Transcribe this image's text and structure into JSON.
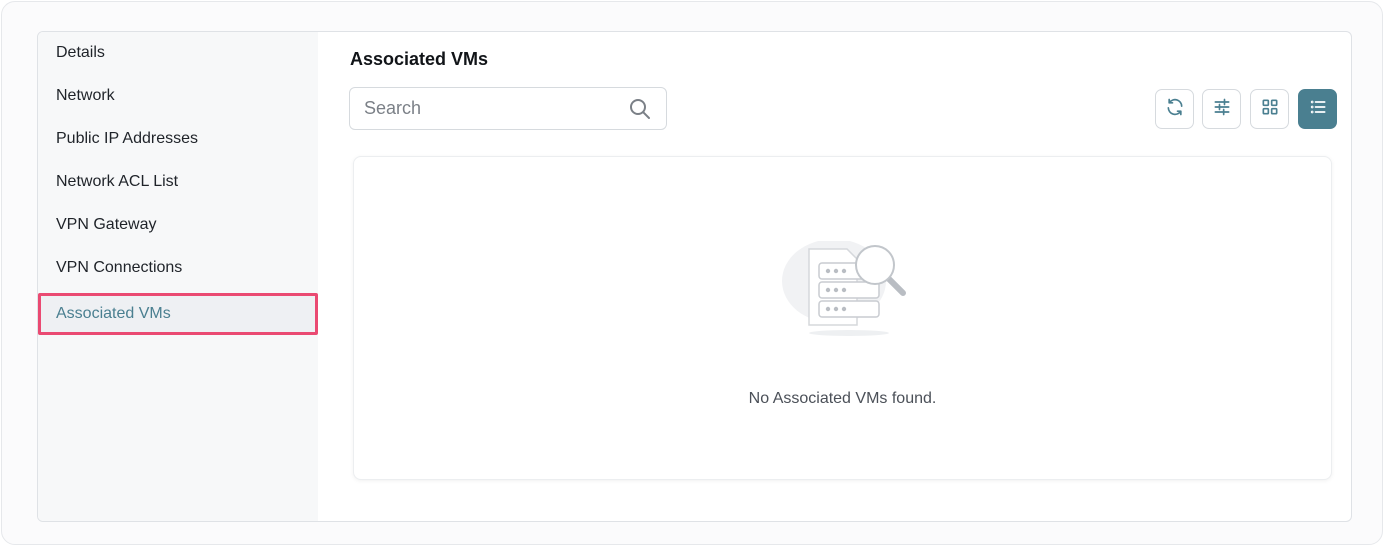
{
  "sidebar": {
    "items": [
      {
        "label": "Details",
        "active": false
      },
      {
        "label": "Network",
        "active": false
      },
      {
        "label": "Public IP Addresses",
        "active": false
      },
      {
        "label": "Network ACL List",
        "active": false
      },
      {
        "label": "VPN Gateway",
        "active": false
      },
      {
        "label": "VPN Connections",
        "active": false
      },
      {
        "label": "Associated VMs",
        "active": true
      }
    ]
  },
  "main": {
    "title": "Associated VMs",
    "search": {
      "placeholder": "Search",
      "value": "",
      "icon": "search-icon"
    },
    "toolbar": [
      {
        "icon": "refresh-icon",
        "active": false
      },
      {
        "icon": "filter-sliders-icon",
        "active": false
      },
      {
        "icon": "grid-view-icon",
        "active": false
      },
      {
        "icon": "list-view-icon",
        "active": true
      }
    ],
    "empty_state": {
      "message": "No Associated VMs found.",
      "icon": "server-search-illustration"
    }
  },
  "colors": {
    "accent": "#4a7f90",
    "highlight_border": "#ea4a72",
    "border": "#d6dade"
  }
}
